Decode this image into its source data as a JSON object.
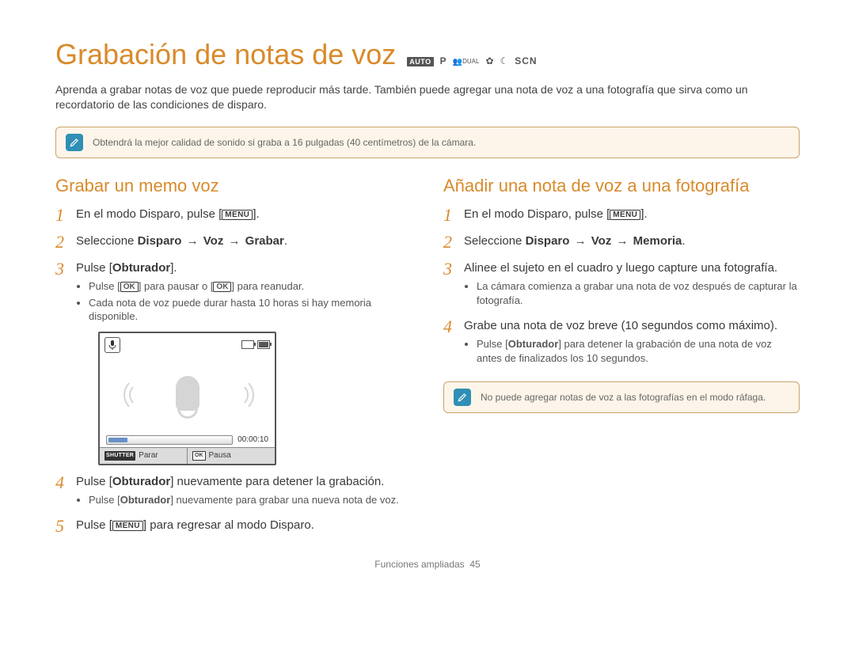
{
  "title": "Grabación de notas de voz",
  "modes": {
    "auto": "AUTO",
    "p": "P",
    "dual": "DUAL",
    "beauty": "✿",
    "night": "☾",
    "scn": "SCN"
  },
  "intro": "Aprenda a grabar notas de voz que puede reproducir más tarde. También puede agregar una nota de voz a una fotografía que sirva como un recordatorio de las condiciones de disparo.",
  "tip": "Obtendrá la mejor calidad de sonido si graba a 16 pulgadas (40 centímetros) de la cámara.",
  "left": {
    "heading": "Grabar un memo voz",
    "s1_a": "En el modo Disparo, pulse [",
    "s1_menu": "MENU",
    "s1_b": "].",
    "s2_a": "Seleccione ",
    "s2_b1": "Disparo",
    "s2_arr": " → ",
    "s2_b2": "Voz",
    "s2_b3": "Grabar",
    "s2_c": ".",
    "s3_a": "Pulse [",
    "s3_b": "Obturador",
    "s3_c": "].",
    "s3_sub1_a": "Pulse [",
    "s3_sub1_ok1": "OK",
    "s3_sub1_b": "] para pausar o [",
    "s3_sub1_ok2": "OK",
    "s3_sub1_c": "] para reanudar.",
    "s3_sub2": "Cada nota de voz puede durar hasta 10 horas si hay memoria disponible.",
    "s4_a": "Pulse [",
    "s4_b": "Obturador",
    "s4_c": "] nuevamente para detener la grabación.",
    "s4_sub_a": "Pulse [",
    "s4_sub_b": "Obturador",
    "s4_sub_c": "] nuevamente para grabar una nueva nota de voz.",
    "s5_a": "Pulse [",
    "s5_menu": "MENU",
    "s5_b": "] para regresar al modo Disparo."
  },
  "lcd": {
    "time": "00:00:10",
    "shutter_tag": "SHUTTER",
    "stop": "Parar",
    "ok_tag": "OK",
    "pause": "Pausa"
  },
  "right": {
    "heading": "Añadir una nota de voz a una fotografía",
    "s1_a": "En el modo Disparo, pulse [",
    "s1_menu": "MENU",
    "s1_b": "].",
    "s2_a": "Seleccione ",
    "s2_b1": "Disparo",
    "s2_arr": " → ",
    "s2_b2": "Voz",
    "s2_b3": "Memoria",
    "s2_c": ".",
    "s3": "Alinee el sujeto en el cuadro y luego capture una fotografía.",
    "s3_sub": "La cámara comienza a grabar una nota de voz después de capturar la fotografía.",
    "s4": "Grabe una nota de voz breve (10 segundos como máximo).",
    "s4_sub_a": "Pulse [",
    "s4_sub_b": "Obturador",
    "s4_sub_c": "] para detener la grabación de una nota de voz antes de finalizados los 10 segundos.",
    "note": "No puede agregar notas de voz a las fotografías en el modo ráfaga."
  },
  "footer_a": "Funciones ampliadas",
  "footer_b": "45"
}
